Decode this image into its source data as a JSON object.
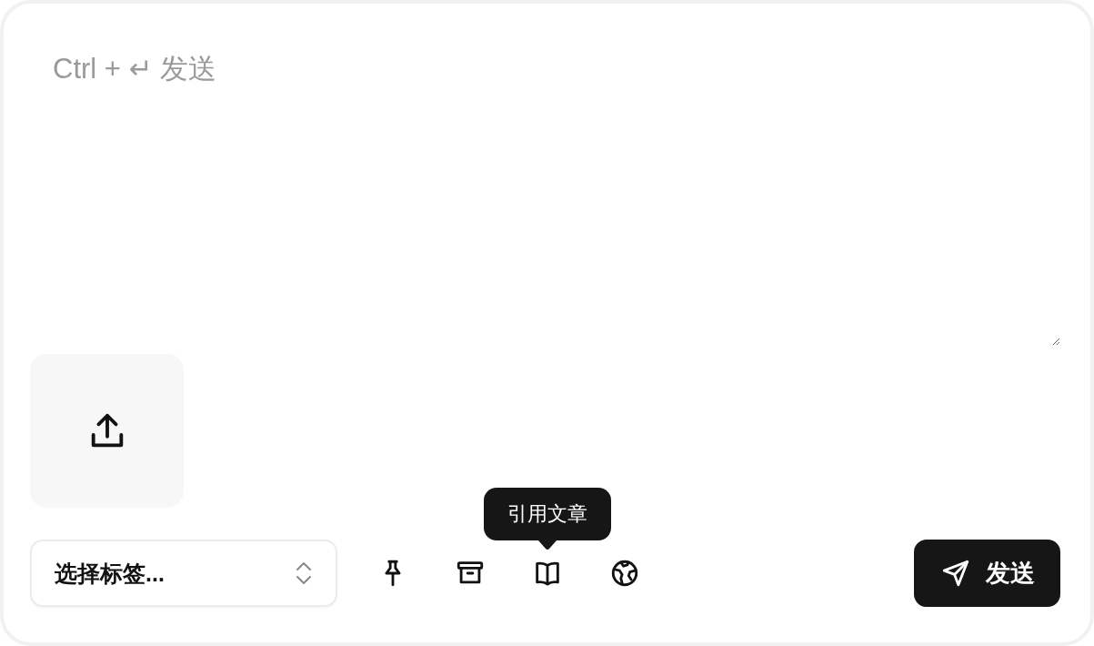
{
  "composer": {
    "placeholder": "Ctrl + ↵ 发送"
  },
  "tag_select": {
    "placeholder": "选择标签..."
  },
  "tools": [
    {
      "kind": "pin"
    },
    {
      "kind": "archive"
    },
    {
      "kind": "book",
      "tooltip": "引用文章"
    },
    {
      "kind": "globe"
    }
  ],
  "send_button": {
    "label": "发送"
  }
}
